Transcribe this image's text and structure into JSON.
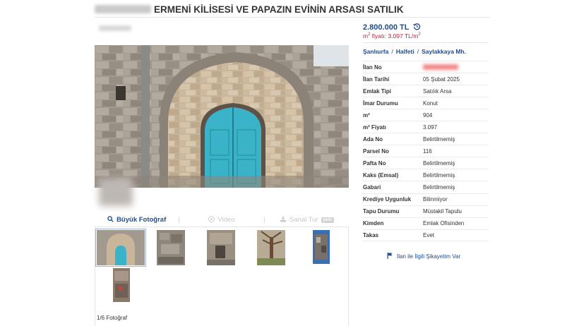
{
  "listing": {
    "title": "ERMENİ KİLİSESİ VE PAPAZIN EVİNİN ARSASI SATILIK"
  },
  "price": {
    "value": "2.800.000 TL",
    "m2_label": "m",
    "m2_sup": "2",
    "m2_text": " fiyatı: 3.097 TL/m",
    "m2_sup2": "2"
  },
  "location": {
    "city": "Şanlıurfa",
    "district": "Halfeti",
    "neighborhood": "Saylakkaya Mh.",
    "separator": "/"
  },
  "details": [
    {
      "label": "İlan No",
      "value": ""
    },
    {
      "label": "İlan Tarihi",
      "value": "05 Şubat 2025"
    },
    {
      "label": "Emlak Tipi",
      "value": "Satılık Arsa"
    },
    {
      "label": "İmar Durumu",
      "value": "Konut"
    },
    {
      "label": "m²",
      "value": "904"
    },
    {
      "label": "m² Fiyatı",
      "value": "3.097"
    },
    {
      "label": "Ada No",
      "value": "Belirtilmemiş"
    },
    {
      "label": "Parsel No",
      "value": "116"
    },
    {
      "label": "Pafta No",
      "value": "Belirtilmemiş"
    },
    {
      "label": "Kaks (Emsal)",
      "value": "Belirtilmemiş"
    },
    {
      "label": "Gabari",
      "value": "Belirtilmemiş"
    },
    {
      "label": "Krediye Uygunluk",
      "value": "Bilinmiyor"
    },
    {
      "label": "Tapu Durumu",
      "value": "Müstakil Tapulu"
    },
    {
      "label": "Kimden",
      "value": "Emlak Ofisinden"
    },
    {
      "label": "Takas",
      "value": "Evet"
    }
  ],
  "media": {
    "big_photo": "Büyük Fotoğraf",
    "video": "Video",
    "virtual_tour": "Sanal Tur",
    "new_badge": "yeni",
    "counter": "1/6 Fotoğraf"
  },
  "complaint_link": "İlan ile İlgili Şikayetim Var",
  "icons": {
    "history": "history-icon",
    "search": "magnifier-icon",
    "video": "play-icon",
    "tour": "download-icon",
    "flag": "flag-icon"
  },
  "colors": {
    "accent": "#1f4b8f",
    "price_m2": "#b3263e",
    "door": "#3ab3c9"
  }
}
